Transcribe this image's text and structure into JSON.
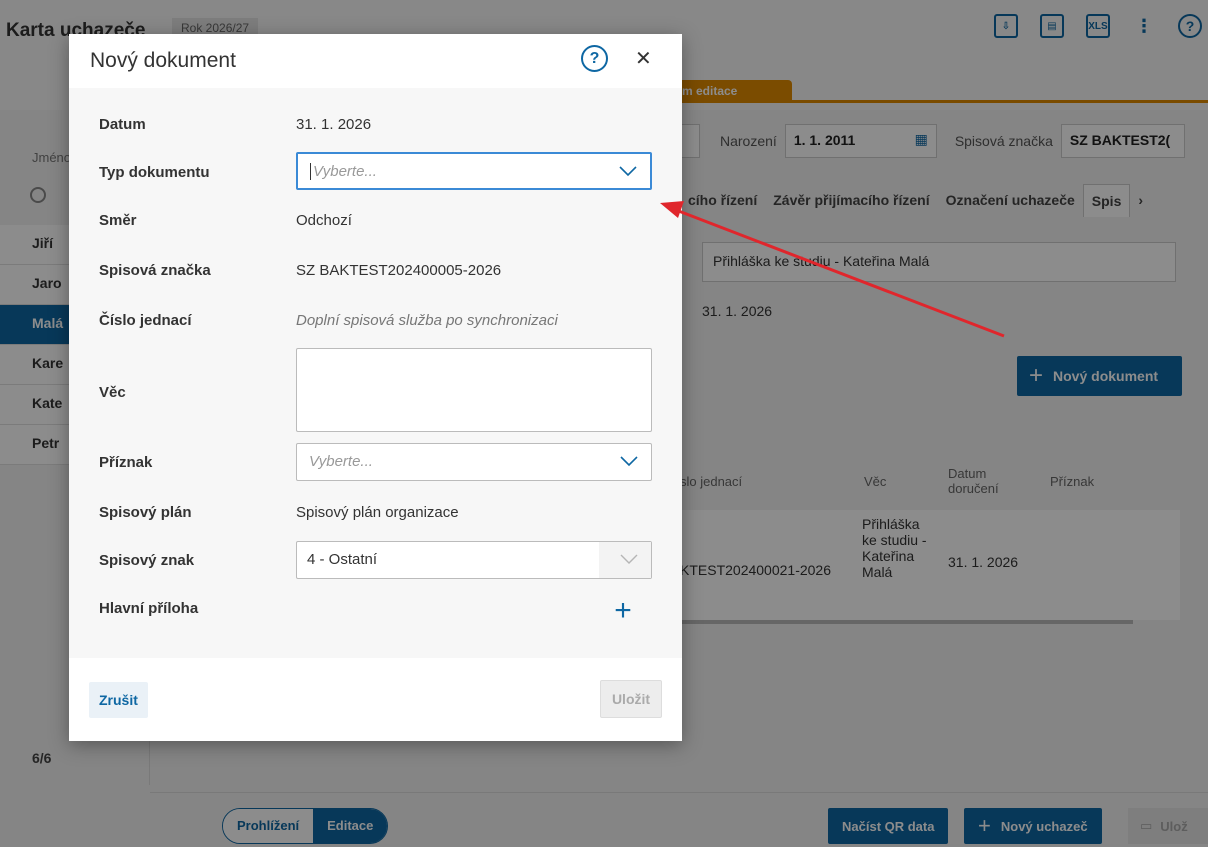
{
  "app": {
    "title": "Karta uchazeče",
    "year": "Rok 2026/27",
    "edit_tab": "m editace",
    "birth_label": "Narození",
    "birth_value": "1. 1. 2011",
    "file_mark_label": "Spisová značka",
    "file_mark_value": "SZ BAKTEST2(",
    "name_label": "Jméno",
    "tabs": [
      "cího řízení",
      "Závěr přijímacího řízení",
      "Označení uchazeče",
      "Spis"
    ],
    "subject_value": "Přihláška ke studiu - Kateřina Malá",
    "doc_date": "31. 1. 2026",
    "new_doc_button": "Nový dokument",
    "table_headers": [
      "slo jednací",
      "Věc",
      "Datum doručení",
      "Příznak"
    ],
    "table_row": {
      "ref": "KTEST202400021-2026",
      "subject": "Přihláška ke studiu - Kateřina Malá",
      "delivered": "31. 1. 2026"
    },
    "sidebar_items": [
      "Jiří",
      "Jaro",
      "Malá",
      "Kare",
      "Kate",
      "Petr"
    ],
    "count": "6/6",
    "mode_view": "Prohlížení",
    "mode_edit": "Editace",
    "qr_button": "Načíst QR data",
    "new_applicant_button": "Nový uchazeč",
    "save_bottom": "Ulož"
  },
  "modal": {
    "title": "Nový dokument",
    "fields": {
      "date_label": "Datum",
      "date_value": "31. 1. 2026",
      "doctype_label": "Typ dokumentu",
      "doctype_placeholder": "Vyberte...",
      "direction_label": "Směr",
      "direction_value": "Odchozí",
      "filemark_label": "Spisová značka",
      "filemark_value": "SZ BAKTEST202400005-2026",
      "ref_label": "Číslo jednací",
      "ref_value": "Doplní spisová služba po synchronizaci",
      "subject_label": "Věc",
      "flag_label": "Příznak",
      "flag_placeholder": "Vyberte...",
      "plan_label": "Spisový plán",
      "plan_value": "Spisový plán organizace",
      "sign_label": "Spisový znak",
      "sign_value": "4 -  Ostatní",
      "attach_label": "Hlavní příloha"
    },
    "cancel": "Zrušit",
    "save": "Uložit"
  },
  "colors": {
    "primary": "#0e67a3",
    "accent_orange": "#e08a00",
    "highlight_red": "#e0262c",
    "focus_blue": "#3b8ad6"
  }
}
